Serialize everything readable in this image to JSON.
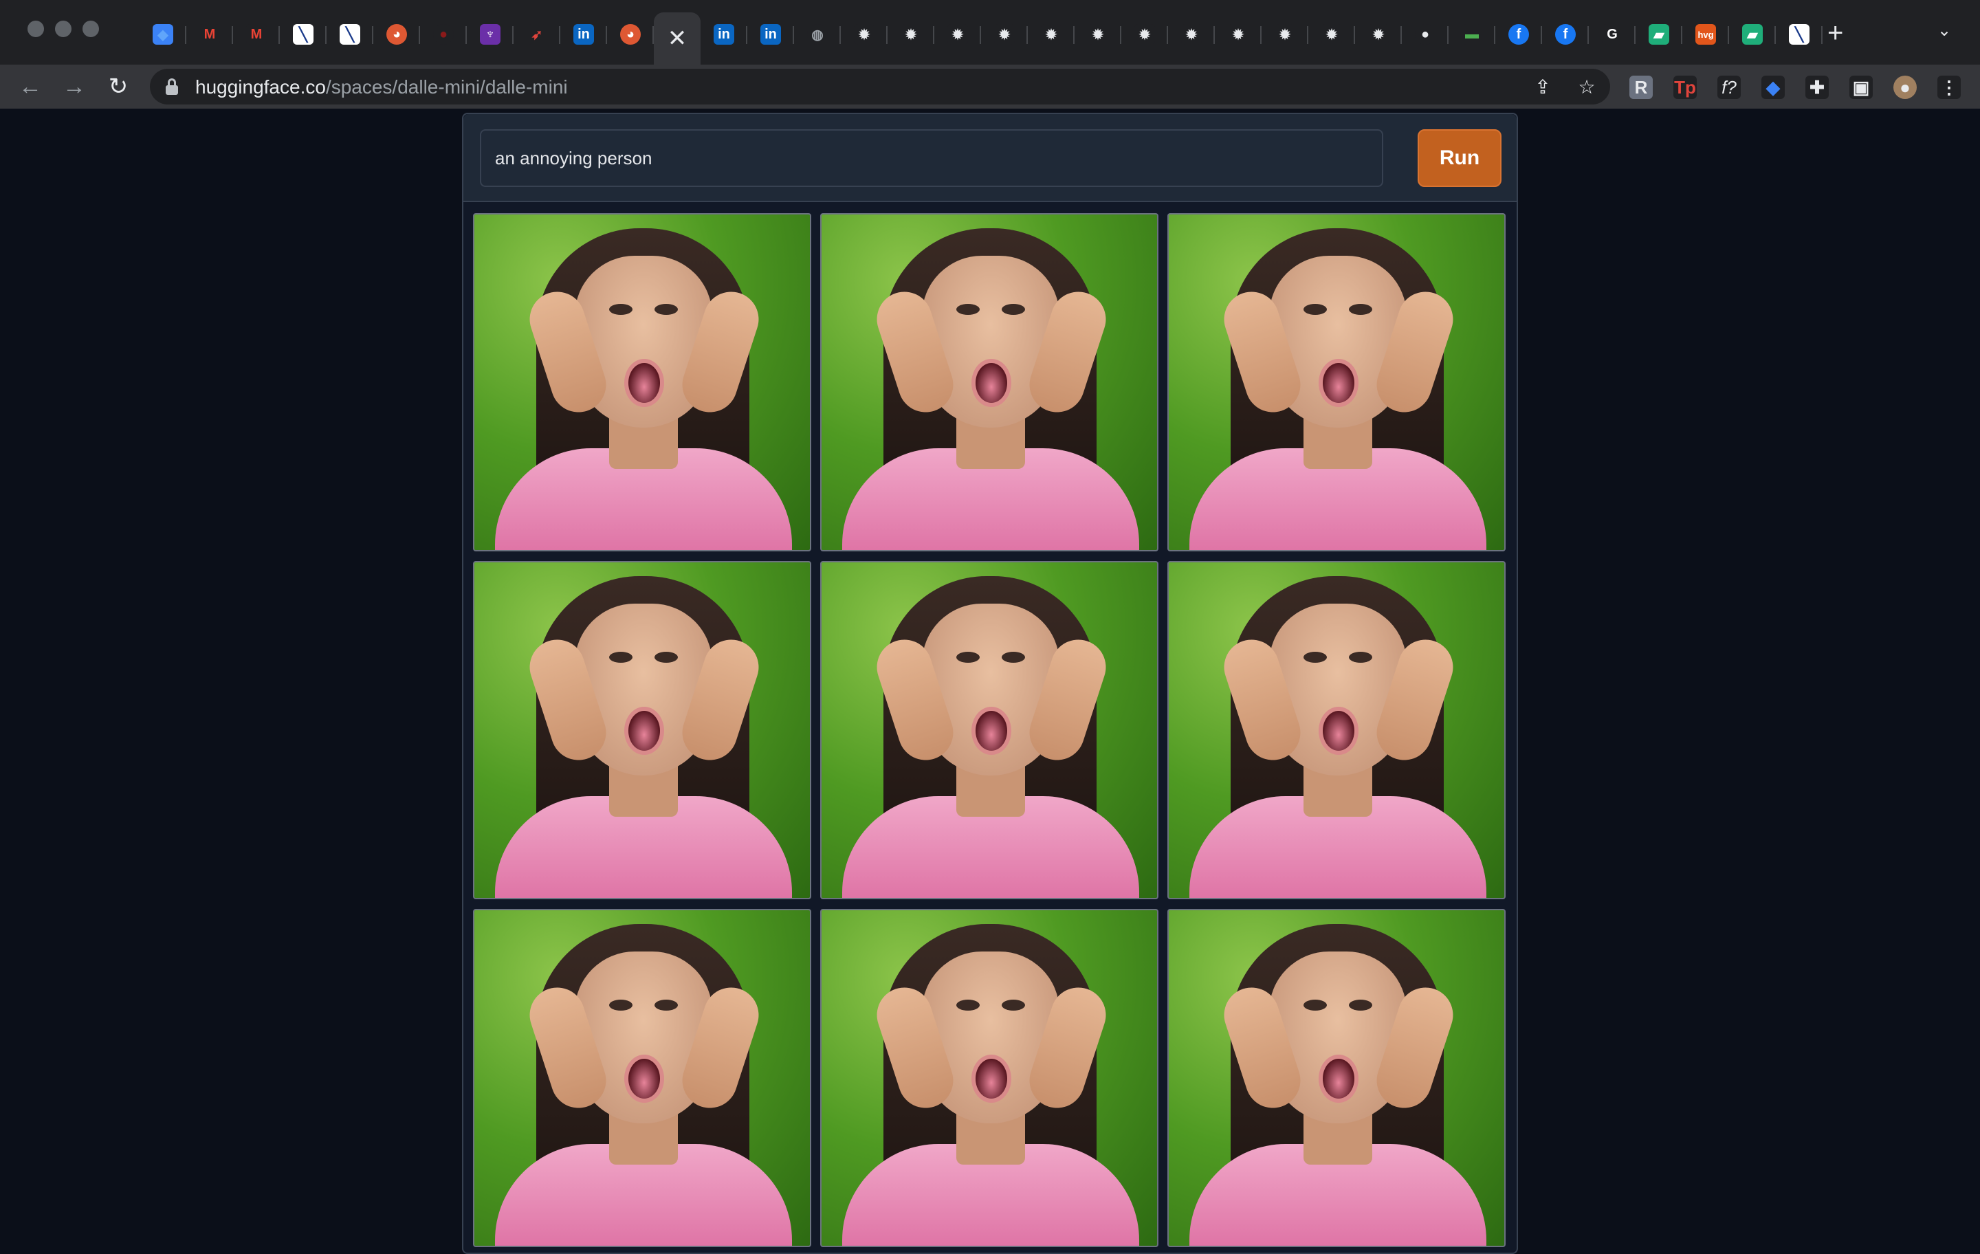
{
  "browser": {
    "tabs": [
      {
        "icon": "diamond-icon",
        "glyph": "◆",
        "color": "#3b82f6",
        "shape": "square",
        "text_color": "#60a5fa"
      },
      {
        "icon": "gmail-icon",
        "glyph": "M",
        "color": "#202124",
        "shape": "square",
        "text_color": "#ea4335"
      },
      {
        "icon": "gmail-icon",
        "glyph": "M",
        "color": "#202124",
        "shape": "square",
        "text_color": "#ea4335"
      },
      {
        "icon": "document-icon",
        "glyph": "╲",
        "color": "#ffffff",
        "shape": "square",
        "text_color": "#1a3a8a"
      },
      {
        "icon": "document-icon",
        "glyph": "╲",
        "color": "#ffffff",
        "shape": "square",
        "text_color": "#1a3a8a"
      },
      {
        "icon": "duckduckgo-icon",
        "glyph": "◕",
        "color": "#de5833",
        "shape": "circle",
        "text_color": "#ffffff"
      },
      {
        "icon": "red-dot-icon",
        "glyph": "●",
        "color": "#202124",
        "shape": "circle",
        "text_color": "#8b1a1a"
      },
      {
        "icon": "purple-app-icon",
        "glyph": "♆",
        "color": "#6b2fa8",
        "shape": "square",
        "text_color": "#ffffff"
      },
      {
        "icon": "pin-icon",
        "glyph": "➶",
        "color": "#202124",
        "shape": "square",
        "text_color": "#e0443c"
      },
      {
        "icon": "linkedin-icon",
        "glyph": "in",
        "color": "#0a66c2",
        "shape": "square",
        "text_color": "#ffffff"
      },
      {
        "icon": "duckduckgo-icon",
        "glyph": "◕",
        "color": "#de5833",
        "shape": "circle",
        "text_color": "#ffffff"
      },
      {
        "icon": "close-icon",
        "glyph": "✕",
        "color": "",
        "shape": "none",
        "text_color": "#e8eaed",
        "active": true
      },
      {
        "icon": "linkedin-icon",
        "glyph": "in",
        "color": "#0a66c2",
        "shape": "square",
        "text_color": "#ffffff"
      },
      {
        "icon": "linkedin-icon",
        "glyph": "in",
        "color": "#0a66c2",
        "shape": "square",
        "text_color": "#ffffff"
      },
      {
        "icon": "globe-icon",
        "glyph": "◍",
        "color": "#202124",
        "shape": "circle",
        "text_color": "#9aa0a6"
      },
      {
        "icon": "gear-icon",
        "glyph": "✹",
        "color": "#202124",
        "shape": "square",
        "text_color": "#e8eaed"
      },
      {
        "icon": "gear-icon",
        "glyph": "✹",
        "color": "#202124",
        "shape": "square",
        "text_color": "#e8eaed"
      },
      {
        "icon": "gear-icon",
        "glyph": "✹",
        "color": "#202124",
        "shape": "square",
        "text_color": "#e8eaed"
      },
      {
        "icon": "gear-icon",
        "glyph": "✹",
        "color": "#202124",
        "shape": "square",
        "text_color": "#e8eaed"
      },
      {
        "icon": "gear-icon",
        "glyph": "✹",
        "color": "#202124",
        "shape": "square",
        "text_color": "#e8eaed"
      },
      {
        "icon": "gear-icon",
        "glyph": "✹",
        "color": "#202124",
        "shape": "square",
        "text_color": "#e8eaed"
      },
      {
        "icon": "gear-icon",
        "glyph": "✹",
        "color": "#202124",
        "shape": "square",
        "text_color": "#e8eaed"
      },
      {
        "icon": "gear-icon",
        "glyph": "✹",
        "color": "#202124",
        "shape": "square",
        "text_color": "#e8eaed"
      },
      {
        "icon": "gear-icon",
        "glyph": "✹",
        "color": "#202124",
        "shape": "square",
        "text_color": "#e8eaed"
      },
      {
        "icon": "gear-icon",
        "glyph": "✹",
        "color": "#202124",
        "shape": "square",
        "text_color": "#e8eaed"
      },
      {
        "icon": "gear-icon",
        "glyph": "✹",
        "color": "#202124",
        "shape": "square",
        "text_color": "#e8eaed"
      },
      {
        "icon": "gear-icon",
        "glyph": "✹",
        "color": "#202124",
        "shape": "square",
        "text_color": "#e8eaed"
      },
      {
        "icon": "github-icon",
        "glyph": "●",
        "color": "#202124",
        "shape": "circle",
        "text_color": "#e8eaed"
      },
      {
        "icon": "battery-icon",
        "glyph": "▬",
        "color": "#202124",
        "shape": "square",
        "text_color": "#4caf50"
      },
      {
        "icon": "facebook-icon",
        "glyph": "f",
        "color": "#1877f2",
        "shape": "circle",
        "text_color": "#ffffff"
      },
      {
        "icon": "facebook-icon",
        "glyph": "f",
        "color": "#1877f2",
        "shape": "circle",
        "text_color": "#ffffff"
      },
      {
        "icon": "google-icon",
        "glyph": "G",
        "color": "#202124",
        "shape": "square",
        "text_color": "#ffffff"
      },
      {
        "icon": "bars-icon",
        "glyph": "▰",
        "color": "#1fae7a",
        "shape": "square",
        "text_color": "#ffffff"
      },
      {
        "icon": "hvg-icon",
        "glyph": "hvg",
        "color": "#e2561b",
        "shape": "square",
        "text_color": "#ffffff"
      },
      {
        "icon": "bars-icon",
        "glyph": "▰",
        "color": "#1fae7a",
        "shape": "square",
        "text_color": "#ffffff"
      },
      {
        "icon": "document-icon",
        "glyph": "╲",
        "color": "#ffffff",
        "shape": "square",
        "text_color": "#1a3a8a"
      }
    ],
    "new_tab_glyph": "+",
    "tab_menu_glyph": "⌄",
    "url_host": "huggingface.co",
    "url_path": "/spaces/dalle-mini/dalle-mini",
    "extensions": [
      {
        "icon": "r-extension-icon",
        "glyph": "R",
        "color": "#6b7280"
      },
      {
        "icon": "tp-extension-icon",
        "glyph": "Tp",
        "color": "#202124"
      },
      {
        "icon": "f-question-icon",
        "glyph": "f?",
        "color": "#202124"
      },
      {
        "icon": "diamond-icon",
        "glyph": "◆",
        "color": "#202124"
      },
      {
        "icon": "puzzle-icon",
        "glyph": "✚",
        "color": "#202124"
      },
      {
        "icon": "sidebar-icon",
        "glyph": "▣",
        "color": "#202124"
      },
      {
        "icon": "avatar",
        "glyph": "●",
        "color": "#a08060"
      },
      {
        "icon": "kebab-menu-icon",
        "glyph": "⋮",
        "color": "#202124"
      }
    ]
  },
  "app": {
    "prompt_value": "an annoying person",
    "run_label": "Run",
    "images": [
      {
        "alt": "generated image 1"
      },
      {
        "alt": "generated image 2"
      },
      {
        "alt": "generated image 3"
      },
      {
        "alt": "generated image 4"
      },
      {
        "alt": "generated image 5"
      },
      {
        "alt": "generated image 6"
      },
      {
        "alt": "generated image 7"
      },
      {
        "alt": "generated image 8"
      },
      {
        "alt": "generated image 9"
      }
    ]
  }
}
